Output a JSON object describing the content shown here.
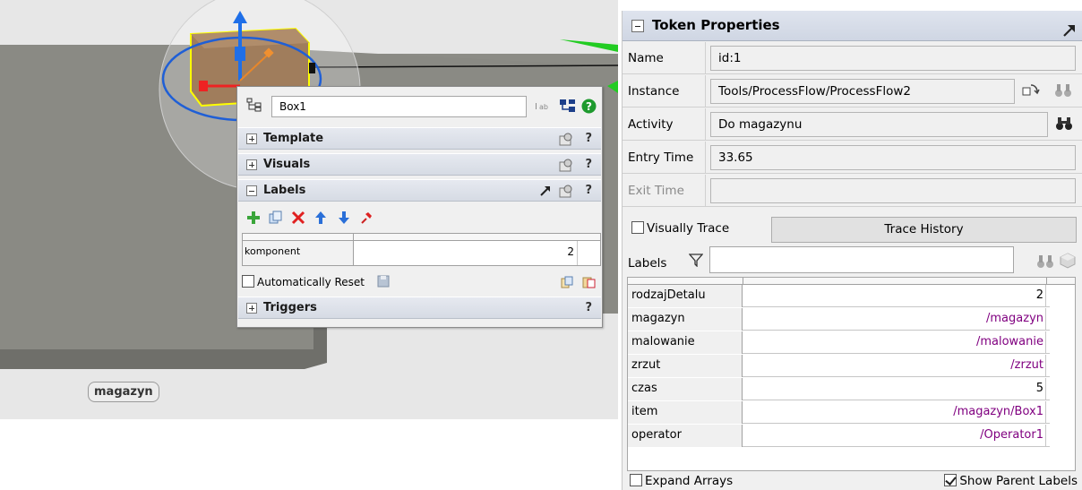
{
  "viewport": {
    "floor_label": "magazyn"
  },
  "quick_properties": {
    "object_name": "Box1",
    "sections": {
      "template": "Template",
      "visuals": "Visuals",
      "labels": "Labels",
      "triggers": "Triggers"
    },
    "help_mark": "?",
    "labels_table": {
      "rows": [
        {
          "name": "komponent",
          "value": "2"
        }
      ]
    },
    "auto_reset_label": "Automatically Reset",
    "auto_reset_checked": false
  },
  "token_properties": {
    "title": "Token Properties",
    "fields": {
      "name_label": "Name",
      "name_value": "id:1",
      "instance_label": "Instance",
      "instance_value": "Tools/ProcessFlow/ProcessFlow2",
      "activity_label": "Activity",
      "activity_value": "Do magazynu",
      "entry_time_label": "Entry Time",
      "entry_time_value": "33.65",
      "exit_time_label": "Exit Time",
      "exit_time_value": ""
    },
    "visually_trace_label": "Visually Trace",
    "visually_trace_checked": false,
    "trace_history_button": "Trace History",
    "labels_label": "Labels",
    "labels_filter_value": "",
    "labels": [
      {
        "name": "rodzajDetalu",
        "value": "2",
        "pointer": false
      },
      {
        "name": "magazyn",
        "value": "/magazyn",
        "pointer": true
      },
      {
        "name": "malowanie",
        "value": "/malowanie",
        "pointer": true
      },
      {
        "name": "zrzut",
        "value": "/zrzut",
        "pointer": true
      },
      {
        "name": "czas",
        "value": "5",
        "pointer": false
      },
      {
        "name": "item",
        "value": "/magazyn/Box1",
        "pointer": true
      },
      {
        "name": "operator",
        "value": "/Operator1",
        "pointer": true
      }
    ],
    "expand_arrays_label": "Expand Arrays",
    "expand_arrays_checked": false,
    "show_parent_labels_label": "Show Parent Labels",
    "show_parent_labels_checked": true
  },
  "colors": {
    "pointer_value": "#800080",
    "floor_top": "#8a8a84",
    "box_fill": "#9a7a5c",
    "selection_outline": "#ffff00",
    "green_flow": "#22cc22"
  }
}
